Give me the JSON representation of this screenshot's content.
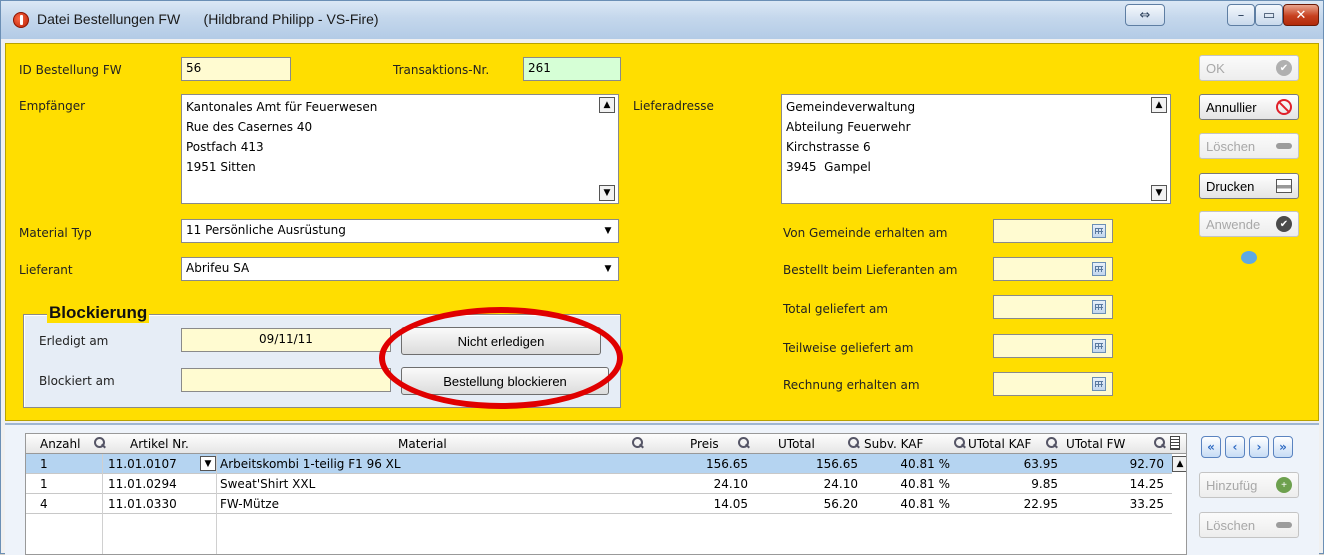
{
  "window": {
    "title": "Datei Bestellungen FW",
    "user": "(Hildbrand Philipp - VS-Fire)"
  },
  "header": {
    "id_label": "ID Bestellung FW",
    "id_value": "56",
    "trans_label": "Transaktions-Nr.",
    "trans_value": "261",
    "empfaenger_label": "Empfänger",
    "empfaenger_value": "Kantonales Amt für Feuerwesen\nRue des Casernes 40\nPostfach 413\n1951 Sitten",
    "liefer_label": "Lieferadresse",
    "liefer_value": "Gemeindeverwaltung\nAbteilung Feuerwehr\nKirchstrasse 6\n3945  Gampel",
    "material_label": "Material Typ",
    "material_value": "11 Persönliche Ausrüstung",
    "lieferant_label": "Lieferant",
    "lieferant_value": "Abrifeu SA"
  },
  "dates": {
    "von_gemeinde": "Von Gemeinde erhalten am",
    "bestellt": "Bestellt beim Lieferanten am",
    "total": "Total geliefert am",
    "teilweise": "Teilweise geliefert am",
    "rechnung": "Rechnung erhalten am"
  },
  "blockierung": {
    "title": "Blockierung",
    "erledigt_label": "Erledigt am",
    "erledigt_value": "09/11/11",
    "blockiert_label": "Blockiert am",
    "nicht_erledigen": "Nicht erledigen",
    "bestellung_blockieren": "Bestellung blockieren"
  },
  "actions": {
    "ok": "OK",
    "annullier": "Annullier",
    "loeschen": "Löschen",
    "drucken": "Drucken",
    "anwende": "Anwende",
    "hinzufueg": "Hinzufüg",
    "loeschen2": "Löschen"
  },
  "grid": {
    "headers": [
      "Anzahl",
      "Artikel Nr.",
      "Material",
      "Preis",
      "UTotal",
      "Subv. KAF",
      "UTotal KAF",
      "UTotal FW"
    ],
    "rows": [
      {
        "anzahl": "1",
        "artikel": "11.01.0107",
        "material": "Arbeitskombi 1-teilig F1 96 XL",
        "preis": "156.65",
        "utotal": "156.65",
        "subv": "40.81 %",
        "utotal_kaf": "63.95",
        "utotal_fw": "92.70"
      },
      {
        "anzahl": "1",
        "artikel": "11.01.0294",
        "material": "Sweat'Shirt XXL",
        "preis": "24.10",
        "utotal": "24.10",
        "subv": "40.81 %",
        "utotal_kaf": "9.85",
        "utotal_fw": "14.25"
      },
      {
        "anzahl": "4",
        "artikel": "11.01.0330",
        "material": "FW-Mütze",
        "preis": "14.05",
        "utotal": "56.20",
        "subv": "40.81 %",
        "utotal_kaf": "22.95",
        "utotal_fw": "33.25"
      }
    ]
  },
  "colors": {
    "form_bg": "#ffde00",
    "annotation": "#e00000",
    "selected_row": "#b5d4f1"
  }
}
